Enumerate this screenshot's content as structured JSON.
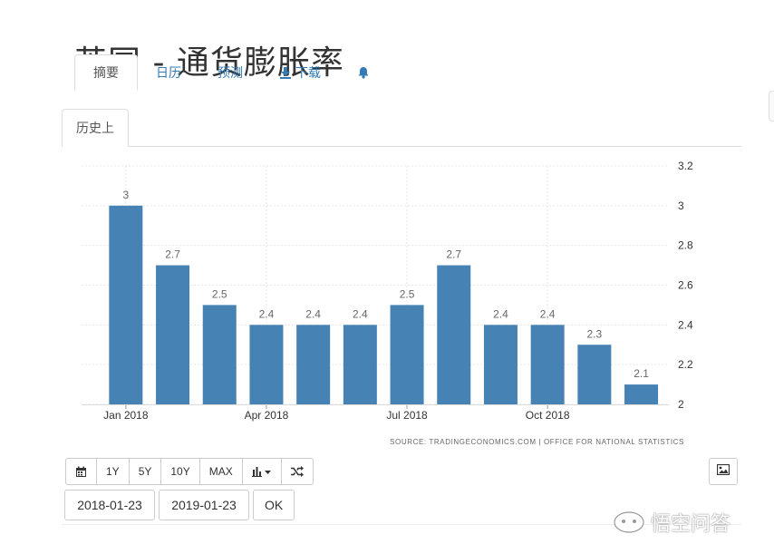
{
  "page": {
    "title": "英国 - 通货膨胀率"
  },
  "top_tabs": [
    {
      "label": "摘要",
      "active": true
    },
    {
      "label": "日历"
    },
    {
      "label": "预测"
    },
    {
      "label": "下载",
      "icon": "download-icon"
    },
    {
      "label": "",
      "icon": "bell-icon"
    }
  ],
  "sub_tab": {
    "label": "历史上"
  },
  "colors": {
    "bar": "#4682b4",
    "grid": "#e6e6e6",
    "link": "#337ab7",
    "text": "#666666"
  },
  "chart_data": {
    "type": "bar",
    "categories": [
      "2018-01",
      "2018-02",
      "2018-03",
      "2018-04",
      "2018-05",
      "2018-06",
      "2018-07",
      "2018-08",
      "2018-09",
      "2018-10",
      "2018-11",
      "2018-12"
    ],
    "values": [
      3,
      2.7,
      2.5,
      2.4,
      2.4,
      2.4,
      2.5,
      2.7,
      2.4,
      2.4,
      2.3,
      2.1
    ],
    "data_labels": [
      "3",
      "2.7",
      "2.5",
      "2.4",
      "2.4",
      "2.4",
      "2.5",
      "2.7",
      "2.4",
      "2.4",
      "2.3",
      "2.1"
    ],
    "x_tick_labels": [
      {
        "label": "Jan 2018",
        "at": 0
      },
      {
        "label": "Apr 2018",
        "at": 3
      },
      {
        "label": "Jul 2018",
        "at": 6
      },
      {
        "label": "Oct 2018",
        "at": 9
      }
    ],
    "y_ticks": [
      2,
      2.2,
      2.4,
      2.6,
      2.8,
      3,
      3.2
    ],
    "y_tick_labels": [
      "2",
      "2.2",
      "2.4",
      "2.6",
      "2.8",
      "3",
      "3.2"
    ],
    "ylim": [
      2,
      3.2
    ],
    "y_axis_side": "right",
    "grid": true,
    "title": "",
    "xlabel": "",
    "ylabel": ""
  },
  "source": {
    "text": "SOURCE: TRADINGECONOMICS.COM  |  OFFICE FOR NATIONAL STATISTICS"
  },
  "toolbar": {
    "buttons": [
      {
        "label": "",
        "icon": "calendar-icon"
      },
      {
        "label": "1Y"
      },
      {
        "label": "5Y"
      },
      {
        "label": "10Y"
      },
      {
        "label": "MAX"
      },
      {
        "label": "",
        "icon": "bar-chart-dropdown-icon"
      },
      {
        "label": "",
        "icon": "shuffle-icon"
      }
    ],
    "image_button_icon": "image-icon"
  },
  "date_range": {
    "start": "2018-01-23",
    "end": "2019-01-23",
    "ok_label": "OK"
  },
  "watermark": {
    "text": "悟空问答"
  }
}
